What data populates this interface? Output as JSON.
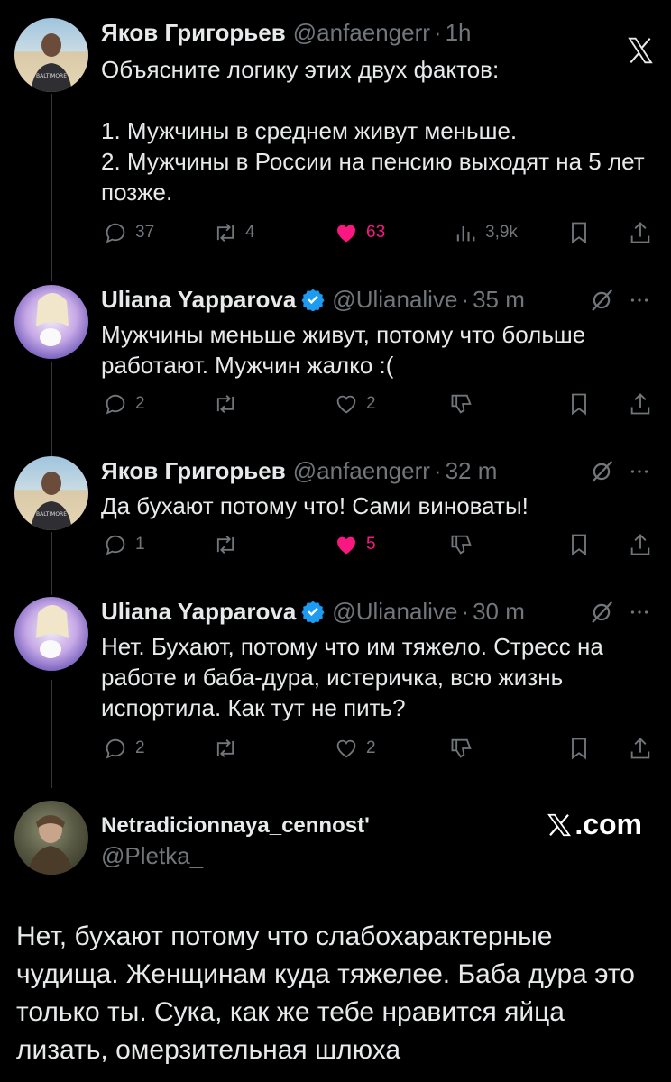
{
  "tweets": [
    {
      "name": "Яков Григорьев",
      "handle": "@anfaengerr",
      "dot": "·",
      "time": "1h",
      "text": "Объясните логику этих двух фактов:\n\n1. Мужчины в среднем живут меньше.\n2. Мужчины в России на пенсию выходят на 5 лет позже.",
      "replies": "37",
      "reposts": "4",
      "likes": "63",
      "views": "3,9k"
    },
    {
      "name": "Uliana Yapparova",
      "handle": "@Ulianalive",
      "dot": "·",
      "time": "35 m",
      "text": "Мужчины меньше живут, потому что больше работают. Мужчин жалко :(",
      "replies": "2",
      "likes": "2"
    },
    {
      "name": "Яков Григорьев",
      "handle": "@anfaengerr",
      "dot": "·",
      "time": "32 m",
      "text": "Да бухают потому что! Сами виноваты!",
      "replies": "1",
      "likes": "5"
    },
    {
      "name": "Uliana Yapparova",
      "handle": "@Ulianalive",
      "dot": "·",
      "time": "30 m",
      "text": "Нет. Бухают, потому что им тяжело. Стресс на работе и баба-дура, истеричка, всю жизнь испортила. Как тут не пить?",
      "replies": "2",
      "likes": "2"
    }
  ],
  "final": {
    "name": "Netradicionnaya_cennost'",
    "handle": "@Pletka_",
    "site": ".com",
    "text": "Нет, бухают потому что слабохарактерные чудища. Женщинам куда тяжелее. Баба дура это только ты. Сука, как же тебе нравится яйца лизать, омерзительная шлюха"
  },
  "colors": {
    "like": "#f91880",
    "muted": "#71767b",
    "verified": "#1d9bf0",
    "background": "#000000"
  },
  "icons": [
    "x-logo-icon",
    "reply-icon",
    "repost-icon",
    "heart-icon",
    "views-icon",
    "bookmark-icon",
    "share-icon",
    "grok-icon",
    "more-icon",
    "verified-icon"
  ]
}
